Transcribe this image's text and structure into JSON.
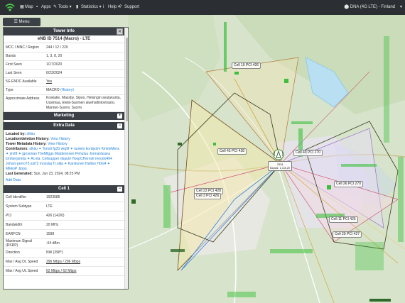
{
  "nav": {
    "map": "Map",
    "apps": "Apps",
    "tools": "Tools",
    "statistics": "Statistics",
    "help": "Help",
    "support": "Support",
    "network": "DNA (4G LTE) - Finland"
  },
  "menu_label": "Menu",
  "panel": {
    "title": "Tower Info",
    "subtitle": "eNB ID 7514 (Macro) - LTE",
    "info_rows": [
      {
        "k": "MCC / MNC / Region",
        "v": "244 / 12 / 220"
      },
      {
        "k": "Bands",
        "v": "1, 3, 8, 20"
      },
      {
        "k": "First Seen",
        "v": "1/27/2020"
      },
      {
        "k": "Last Seen",
        "v": "6/23/2024"
      },
      {
        "k": "5G ENDC Available",
        "v": "Yes"
      },
      {
        "k": "Type",
        "v": "MACRO",
        "v2": "(History)"
      },
      {
        "k": "Approximate Address",
        "v": "Koskatie, Massby, Sipoo, Helsingin seutukunta, Uusimaa, Etelä-Suomen aluehallintovirasto, Manner-Suomi, Suomi"
      }
    ],
    "marketing": "Marketing",
    "extra_data": "Extra Data",
    "located_by_label": "Located by:",
    "located_by": "olkiiu",
    "loc_hist_label": "Location/deletion History:",
    "loc_hist_link": "View History",
    "tower_hist_label": "Tower Metadata History:",
    "tower_hist_link": "View History",
    "contributors_label": "Contributors:",
    "contributors": "olkiiu ✦ Tonoti fg33 vkq9f ✦ luoteto kordpolm KinkinMera ✦ jm28 ✦ jgrosman TheMIggs Matdennsen Pehuluu JormaVasara tomberjsmita ✦ Ar.nta. Celtsupper nbaulri HoopCHernoll renodo494 Johani perro75 juli72 mosslaj TLnilja ✦ Karstunen Halliso H0ni4 ✦ MikkoP Jippu",
    "last_generated_label": "Last Generated:",
    "last_generated": "Sun, Jun 23, 2024, 08:25 PM",
    "add_data": "Add Data",
    "cell_title": "Cell 1",
    "cell_rows": [
      {
        "k": "Cell Identifier",
        "v": "1923585"
      },
      {
        "k": "System Subtype",
        "v": "LTE"
      },
      {
        "k": "PCI",
        "v": "426 (142/0)"
      },
      {
        "k": "Bandwidth",
        "v": "20 MHz"
      },
      {
        "k": "EARFCN",
        "v": "1598"
      },
      {
        "k": "Maximum Signal (RSRP)",
        "v": "-64 dBm"
      },
      {
        "k": "Direction",
        "v": "NW (298°)"
      },
      {
        "k": "Max / Avg DL Speed",
        "v": "296 Mbps / 296 Mbps"
      },
      {
        "k": "Max / Avg UL Speed",
        "v": "62 Mbps / 62 Mbps"
      }
    ]
  },
  "map_labels": {
    "cell10": "Cell 10 PCI 426",
    "cell43": "Cell 43 PCI 428",
    "cell40": "Cell 40 PCI 270",
    "cell23": "Cell 23 PCI 428",
    "cell3": "Cell 3 PCI 426",
    "cell26": "Cell 26 PCI 270",
    "cell11": "Cell 11 PCI 425",
    "cell20": "Cell 20 PCI 427",
    "cell_top": "Cell 1",
    "tower_id": "7514",
    "tower_bands": "Bands: 1,3,8,20"
  },
  "colors": {
    "nav_bg": "#2b2f33",
    "panel_header": "#3b4046",
    "link": "#1e7fd6",
    "coverage_green": "#3dbf3d"
  }
}
